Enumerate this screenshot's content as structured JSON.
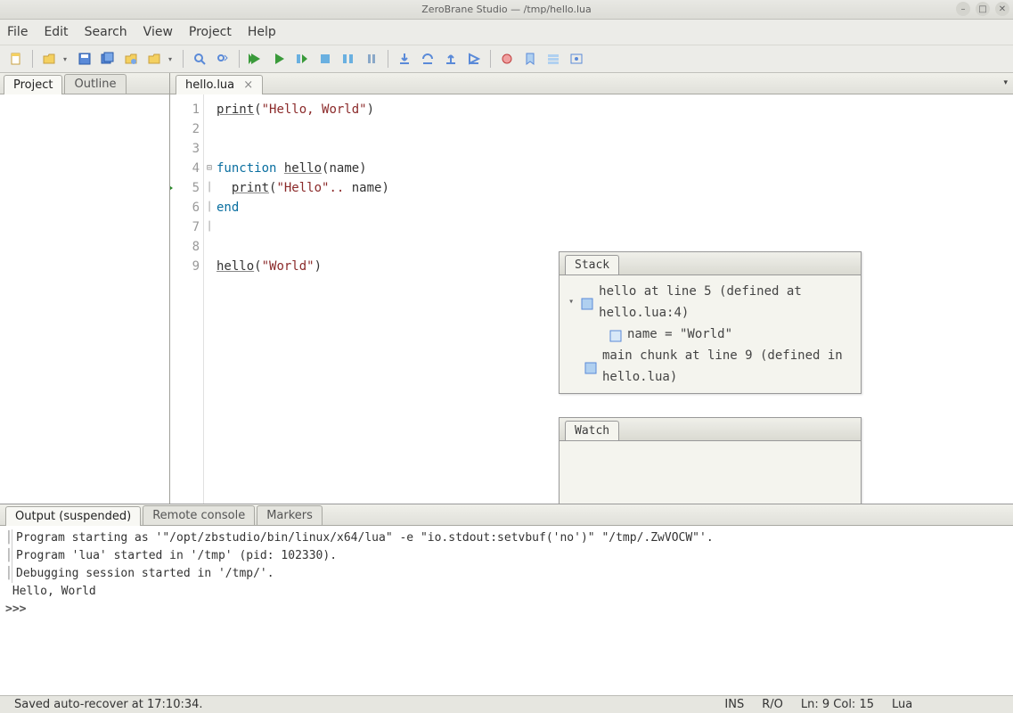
{
  "window": {
    "title": "ZeroBrane Studio — /tmp/hello.lua"
  },
  "menubar": [
    "File",
    "Edit",
    "Search",
    "View",
    "Project",
    "Help"
  ],
  "left_tabs": {
    "project": "Project",
    "outline": "Outline"
  },
  "editor_tab": "hello.lua",
  "code": {
    "lines": [
      {
        "n": "1",
        "html": "<span class='fn'>print</span>(<span class='str'>\"Hello, World\"</span>)"
      },
      {
        "n": "2",
        "html": ""
      },
      {
        "n": "3",
        "html": ""
      },
      {
        "n": "4",
        "html": "<span class='kw'>function</span> <span class='fn'>hello</span>(name)"
      },
      {
        "n": "5",
        "html": "  <span class='fn'>print</span>(<span class='str'>\"Hello\"</span><span class='dots'>..</span> name)"
      },
      {
        "n": "6",
        "html": "<span class='kw'>end</span>"
      },
      {
        "n": "7",
        "html": ""
      },
      {
        "n": "8",
        "html": ""
      },
      {
        "n": "9",
        "html": "<span class='fn'>hello</span>(<span class='str'>\"World\"</span>)"
      }
    ],
    "breakpoint_line": 5
  },
  "stack": {
    "title": "Stack",
    "rows": [
      "hello at line 5 (defined at hello.lua:4)",
      "name = \"World\"",
      "main chunk at line 9 (defined in hello.lua)"
    ]
  },
  "watch": {
    "title": "Watch"
  },
  "bottom_tabs": {
    "output": "Output (suspended)",
    "remote": "Remote console",
    "markers": "Markers"
  },
  "output_lines": [
    "Program starting as '\"/opt/zbstudio/bin/linux/x64/lua\" -e \"io.stdout:setvbuf('no')\" \"/tmp/.ZwVOCW\"'.",
    "Program 'lua' started in '/tmp' (pid: 102330).",
    "Debugging session started in '/tmp/'.",
    "Hello, World"
  ],
  "output_prompt": ">>>",
  "status": {
    "left": "Saved auto-recover at 17:10:34.",
    "ins": "INS",
    "ro": "R/O",
    "pos": "Ln: 9 Col: 15",
    "lang": "Lua"
  }
}
